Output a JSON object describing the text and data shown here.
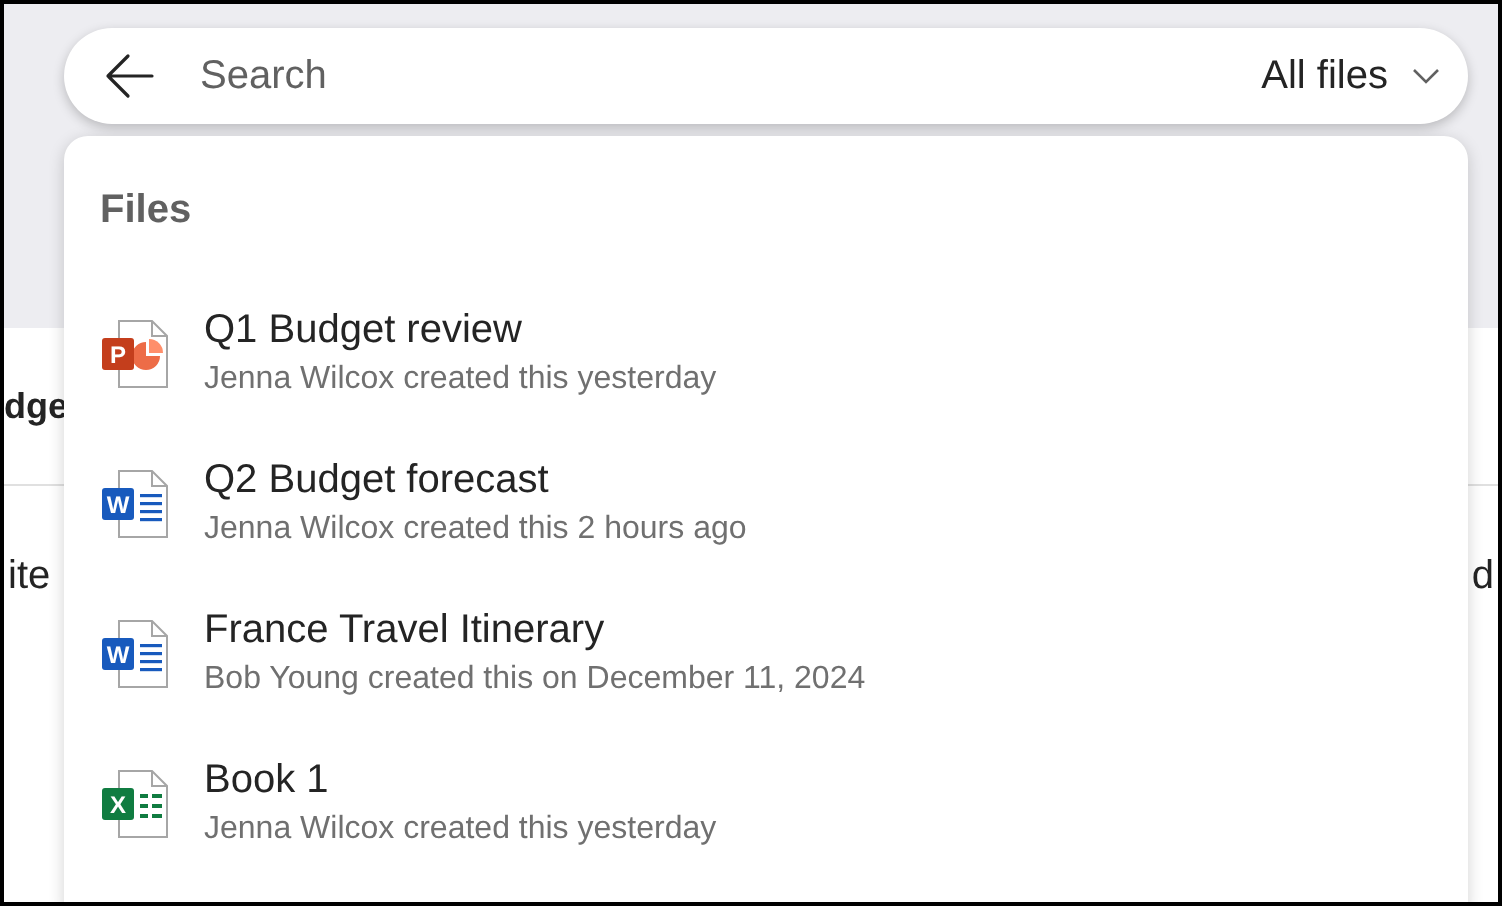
{
  "background": {
    "heading_fragment": "dge",
    "row_fragment_left": "ite",
    "row_fragment_right": "d"
  },
  "search": {
    "placeholder": "Search",
    "scope": "All files"
  },
  "results": {
    "heading": "Files",
    "items": [
      {
        "kind": "powerpoint",
        "letter": "P",
        "title": "Q1 Budget review",
        "detail": "Jenna Wilcox created this yesterday"
      },
      {
        "kind": "word",
        "letter": "W",
        "title": "Q2 Budget forecast",
        "detail": "Jenna Wilcox created this 2 hours ago"
      },
      {
        "kind": "word",
        "letter": "W",
        "title": "France Travel Itinerary",
        "detail": "Bob Young created this on December 11, 2024"
      },
      {
        "kind": "excel",
        "letter": "X",
        "title": "Book 1",
        "detail": "Jenna Wilcox created this yesterday"
      }
    ]
  }
}
